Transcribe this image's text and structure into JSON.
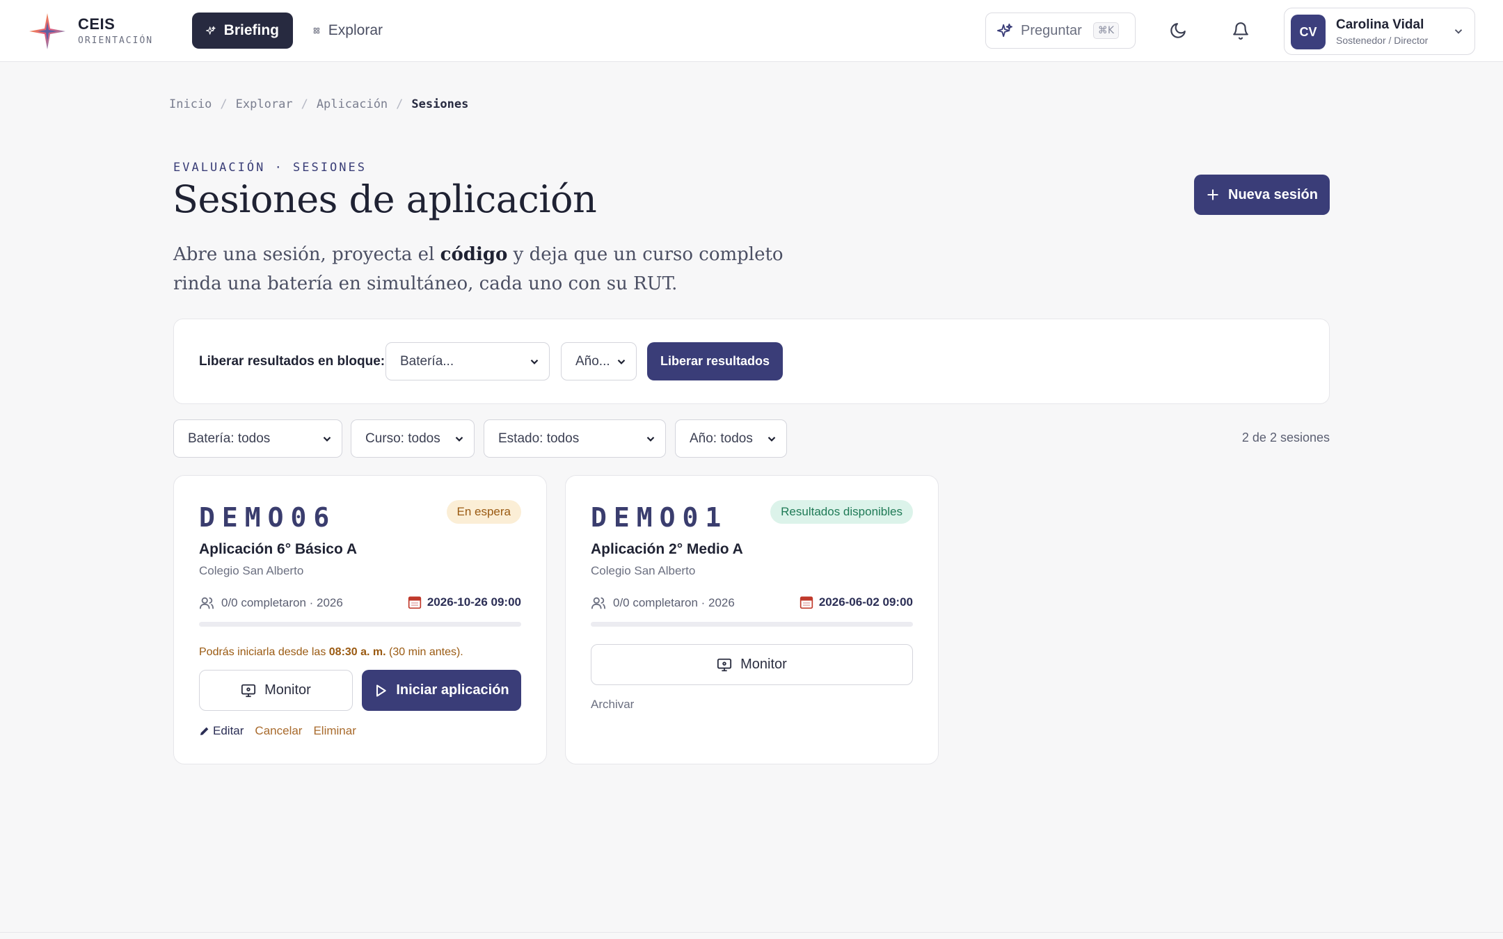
{
  "brand": {
    "name": "CEIS",
    "subtitle": "ORIENTACIÓN"
  },
  "nav": {
    "briefing_label": "Briefing",
    "explorar_label": "Explorar"
  },
  "ask": {
    "label": "Preguntar",
    "shortcut": "⌘K"
  },
  "user": {
    "initials": "CV",
    "name": "Carolina Vidal",
    "role": "Sostenedor / Director"
  },
  "breadcrumb": {
    "items": [
      "Inicio",
      "Explorar",
      "Aplicación",
      "Sesiones"
    ]
  },
  "header": {
    "eyebrow": "EVALUACIÓN · SESIONES",
    "title": "Sesiones de aplicación",
    "lead_pre": "Abre una sesión, proyecta el ",
    "lead_bold": "código",
    "lead_post": " y deja que un curso completo rinda una batería en simultáneo, cada uno con su RUT.",
    "new_button": "Nueva sesión"
  },
  "bulk": {
    "label": "Liberar resultados en bloque:",
    "bateria_select": "Batería...",
    "anio_select": "Año...",
    "button": "Liberar resultados"
  },
  "filters": {
    "bateria": "Batería: todos",
    "curso": "Curso: todos",
    "estado": "Estado: todos",
    "anio": "Año: todos",
    "count": "2 de 2 sesiones"
  },
  "sessions": [
    {
      "code": "DEMO06",
      "status": "En espera",
      "title": "Aplicación 6° Básico A",
      "school": "Colegio San Alberto",
      "meta": "0/0 completaron · 2026",
      "date": "2026-10-26 09:00",
      "progress": 0,
      "notice_pre": "Podrás iniciarla desde las ",
      "notice_time": "08:30 a. m.",
      "notice_post": " (30 min antes).",
      "monitor_label": "Monitor",
      "start_label": "Iniciar aplicación",
      "edit_label": "Editar",
      "cancel_label": "Cancelar",
      "delete_label": "Eliminar"
    },
    {
      "code": "DEMO01",
      "status": "Resultados disponibles",
      "title": "Aplicación 2° Medio A",
      "school": "Colegio San Alberto",
      "meta": "0/0 completaron · 2026",
      "date": "2026-06-02 09:00",
      "progress": 0,
      "monitor_label": "Monitor",
      "archive_label": "Archivar"
    }
  ],
  "colors": {
    "accent": "#3a3d78",
    "nav_active": "#272a40",
    "badge_wait_bg": "#fbeed6",
    "badge_ok_bg": "#dcf3ea"
  }
}
